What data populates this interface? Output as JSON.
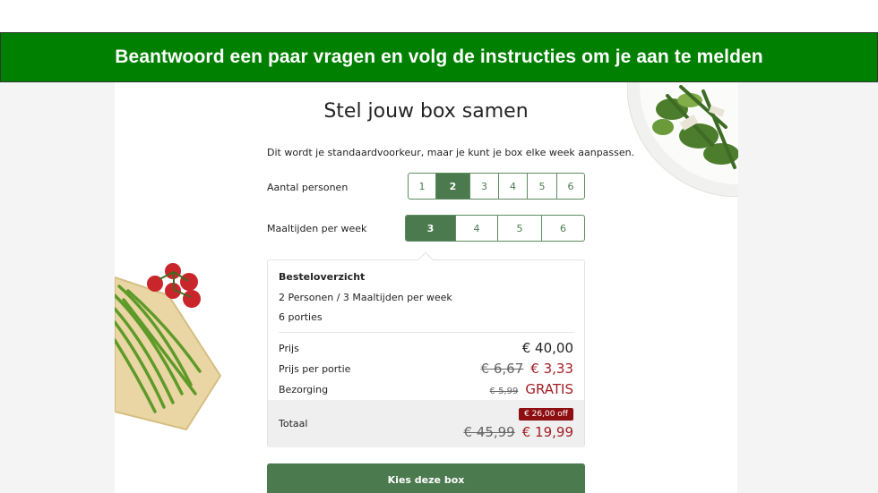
{
  "banner": {
    "text": "Beantwoord een paar vragen en volg de instructies om je aan te melden"
  },
  "page": {
    "title": "Stel jouw box samen",
    "intro": "Dit wordt je standaardvoorkeur, maar je kunt je box elke week aanpassen."
  },
  "persons": {
    "label": "Aantal personen",
    "options": [
      "1",
      "2",
      "3",
      "4",
      "5",
      "6"
    ],
    "selected": "2"
  },
  "meals": {
    "label": "Maaltijden per week",
    "options": [
      "3",
      "4",
      "5",
      "6"
    ],
    "selected": "3"
  },
  "summary": {
    "title": "Besteloverzicht",
    "line1": "2 Personen / 3 Maaltijden per week",
    "line2": "6 porties",
    "price_label": "Prijs",
    "price_value": "€ 40,00",
    "per_portion_label": "Prijs per portie",
    "per_portion_old": "€ 6,67",
    "per_portion_new": "€ 3,33",
    "delivery_label": "Bezorging",
    "delivery_old": "€ 5,99",
    "delivery_new": "GRATIS",
    "total_label": "Totaal",
    "discount_badge": "€ 26,00 off",
    "total_old": "€ 45,99",
    "total_new": "€ 19,99"
  },
  "cta": {
    "label": "Kies deze box"
  },
  "colors": {
    "banner_green": "#008000",
    "brand_green": "#4a7a4e",
    "discount_red": "#a11d23",
    "badge_red": "#8d0f12"
  }
}
